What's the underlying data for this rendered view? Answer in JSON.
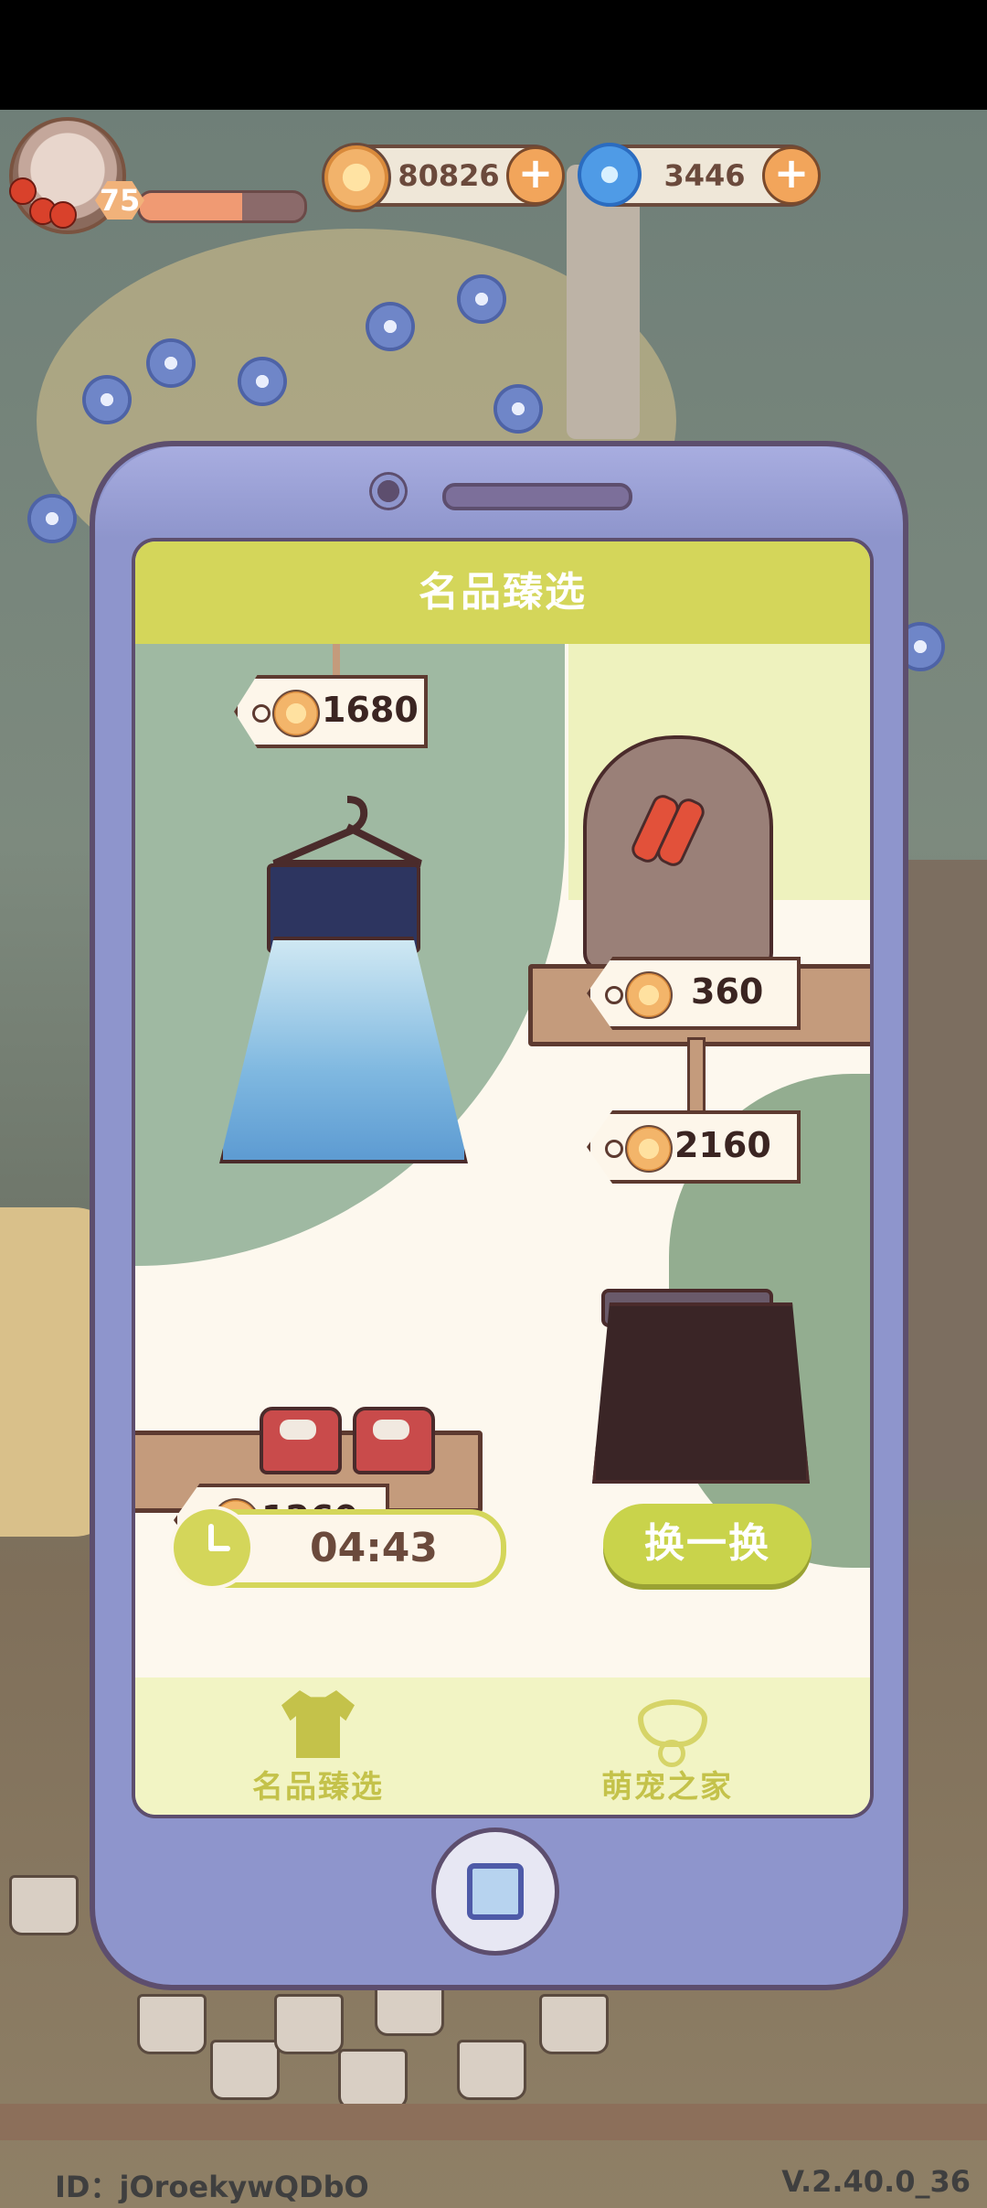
{
  "hud": {
    "level": "75",
    "hp_fraction": 0.62,
    "coins": "80826",
    "gems": "3446"
  },
  "shop": {
    "title": "名品臻选",
    "items": [
      {
        "name": "blue-dress",
        "price": "1680"
      },
      {
        "name": "red-hairpins",
        "price": "360"
      },
      {
        "name": "black-skirt",
        "price": "2160"
      },
      {
        "name": "red-shoes",
        "price": "1260"
      }
    ],
    "timer": "04:43",
    "refresh_label": "换一换"
  },
  "nav": [
    {
      "label": "名品臻选",
      "icon": "shirt-icon"
    },
    {
      "label": "萌宠之家",
      "icon": "pet-collar-icon"
    }
  ],
  "footer": {
    "id_text": "ID：jOroekywQDbO",
    "version": "V.2.40.0_36"
  },
  "colors": {
    "accent": "#d4d65a",
    "phone": "#8e95cc",
    "price_text": "#3b2522"
  }
}
